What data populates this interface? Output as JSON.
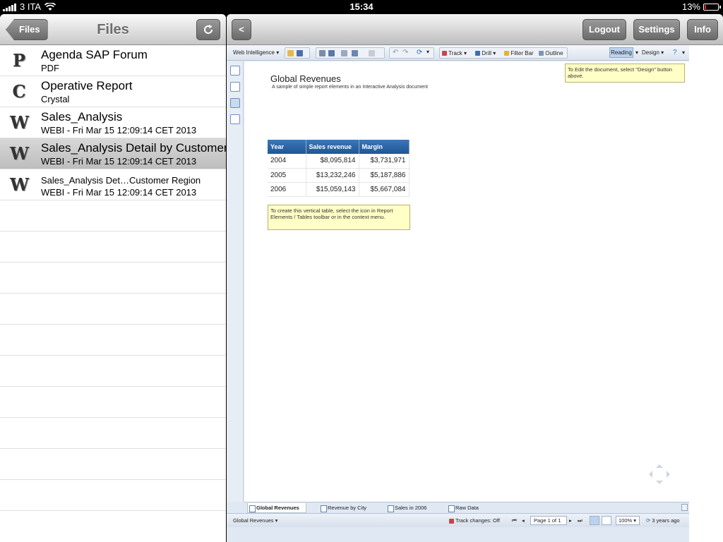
{
  "status_bar": {
    "carrier": "3 ITA",
    "time": "15:34",
    "battery": "13%",
    "battery_level": 0.13
  },
  "files_pane": {
    "back_label": "Files",
    "title": "Files",
    "refresh_icon": "refresh-icon",
    "items": [
      {
        "icon_letter": "P",
        "name": "Agenda SAP Forum",
        "subtitle": "PDF",
        "selected": false
      },
      {
        "icon_letter": "C",
        "name": "Operative Report",
        "subtitle": "Crystal",
        "selected": false
      },
      {
        "icon_letter": "W",
        "name": "Sales_Analysis",
        "subtitle": "WEBI - Fri Mar 15 12:09:14 CET 2013",
        "selected": false
      },
      {
        "icon_letter": "W",
        "name": "Sales_Analysis Detail by Customer",
        "subtitle": "WEBI - Fri Mar 15 12:09:14 CET 2013",
        "selected": true
      },
      {
        "icon_letter": "W",
        "name": "Sales_Analysis Det…Customer Region",
        "subtitle": "WEBI - Fri Mar 15 12:09:14 CET 2013",
        "selected": false
      }
    ]
  },
  "doc_navbar": {
    "back_label": "<",
    "logout_label": "Logout",
    "settings_label": "Settings",
    "info_label": "Info"
  },
  "webi": {
    "toolbar": {
      "app_menu": "Web Intelligence",
      "track": "Track",
      "drill": "Drill",
      "filter_bar": "Filter Bar",
      "outline": "Outline",
      "reading": "Reading",
      "design": "Design"
    },
    "report": {
      "title": "Global Revenues",
      "subtitle": "A sample of simple report elements in an Interactive Analysis document",
      "design_note": "To Edit the document, select \"Design\" button above.",
      "table_note": "To create this vertical table, select the icon in Report Elements / Tables toolbar or in the context menu.",
      "table": {
        "headers": [
          "Year",
          "Sales revenue",
          "Margin"
        ],
        "rows": [
          [
            "2004",
            "$8,095,814",
            "$3,731,971"
          ],
          [
            "2005",
            "$13,232,246",
            "$5,187,886"
          ],
          [
            "2006",
            "$15,059,143",
            "$5,667,084"
          ]
        ]
      }
    },
    "tabs": [
      "Global Revenues",
      "Revenue by City",
      "Sales in 2006",
      "Raw Data"
    ],
    "status": {
      "report_select": "Global Revenues",
      "track_changes": "Track changes: Off",
      "page": "Page 1 of 1",
      "zoom": "100%",
      "refreshed": "3 years ago"
    },
    "colors": {
      "table_header": "#1e5697",
      "note_bg": "#ffffc6",
      "toolbar_bg": "#dfe8f3"
    }
  }
}
